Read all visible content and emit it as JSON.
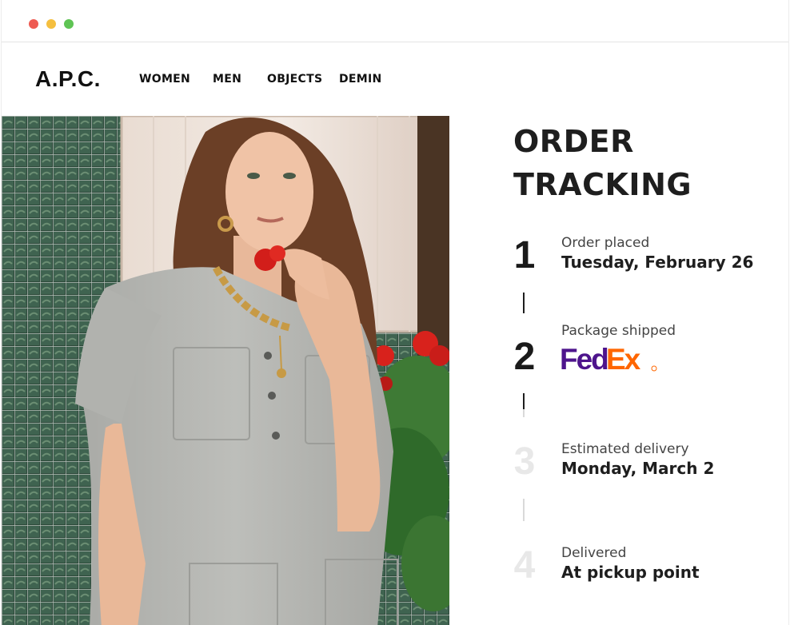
{
  "brand": {
    "logo": "A.P.C."
  },
  "nav": {
    "items": [
      {
        "label": "WOMEN"
      },
      {
        "label": "MEN"
      },
      {
        "label": "OBJECTS"
      },
      {
        "label": "DEMIN"
      }
    ]
  },
  "tracking": {
    "title_line1": "ORDER",
    "title_line2": "TRACKING",
    "steps": [
      {
        "number": "1",
        "label": "Order placed",
        "value": "Tuesday, February 26",
        "status": "complete"
      },
      {
        "number": "2",
        "label": "Package shipped",
        "carrier_logo": "FedEx",
        "status": "complete"
      },
      {
        "number": "3",
        "label": "Estimated delivery",
        "value": "Monday, March 2",
        "status": "pending"
      },
      {
        "number": "4",
        "label": "Delivered",
        "value": "At pickup point",
        "status": "pending"
      }
    ]
  },
  "colors": {
    "fedex_purple": "#4d148c",
    "fedex_orange": "#ff6600",
    "pending_number": "#e8e8e8",
    "text_dark": "#1e1e1e"
  }
}
